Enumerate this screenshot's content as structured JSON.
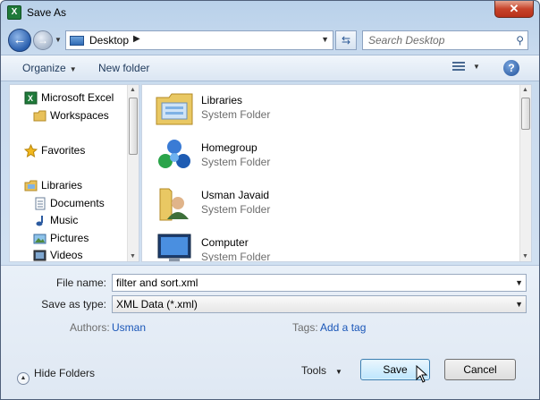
{
  "window": {
    "title": "Save As",
    "close_label": "✕"
  },
  "nav": {
    "back_glyph": "←",
    "forward_glyph": "→",
    "address_location": "Desktop",
    "search_placeholder": "Search Desktop"
  },
  "toolbar": {
    "organize": "Organize",
    "new_folder": "New folder",
    "help": "?"
  },
  "navpane": {
    "items": [
      {
        "label": "Microsoft Excel",
        "icon": "excel-icon"
      },
      {
        "label": "Workspaces",
        "icon": "folder-icon"
      },
      {
        "label": "Favorites",
        "icon": "star-icon"
      },
      {
        "label": "Libraries",
        "icon": "libraries-icon"
      },
      {
        "label": "Documents",
        "icon": "documents-icon"
      },
      {
        "label": "Music",
        "icon": "music-icon"
      },
      {
        "label": "Pictures",
        "icon": "pictures-icon"
      },
      {
        "label": "Videos",
        "icon": "videos-icon"
      }
    ]
  },
  "files": [
    {
      "name": "Libraries",
      "type": "System Folder",
      "icon": "libraries-folder-icon"
    },
    {
      "name": "Homegroup",
      "type": "System Folder",
      "icon": "homegroup-icon"
    },
    {
      "name": "Usman Javaid",
      "type": "System Folder",
      "icon": "user-folder-icon"
    },
    {
      "name": "Computer",
      "type": "System Folder",
      "icon": "computer-icon"
    }
  ],
  "form": {
    "file_name_label": "File name:",
    "file_name_value": "filter and sort.xml",
    "save_as_type_label": "Save as type:",
    "save_as_type_value": "XML Data (*.xml)",
    "authors_label": "Authors:",
    "authors_value": "Usman",
    "tags_label": "Tags:",
    "tags_value": "Add a tag"
  },
  "footer": {
    "hide_folders": "Hide Folders",
    "tools": "Tools",
    "save": "Save",
    "cancel": "Cancel"
  }
}
